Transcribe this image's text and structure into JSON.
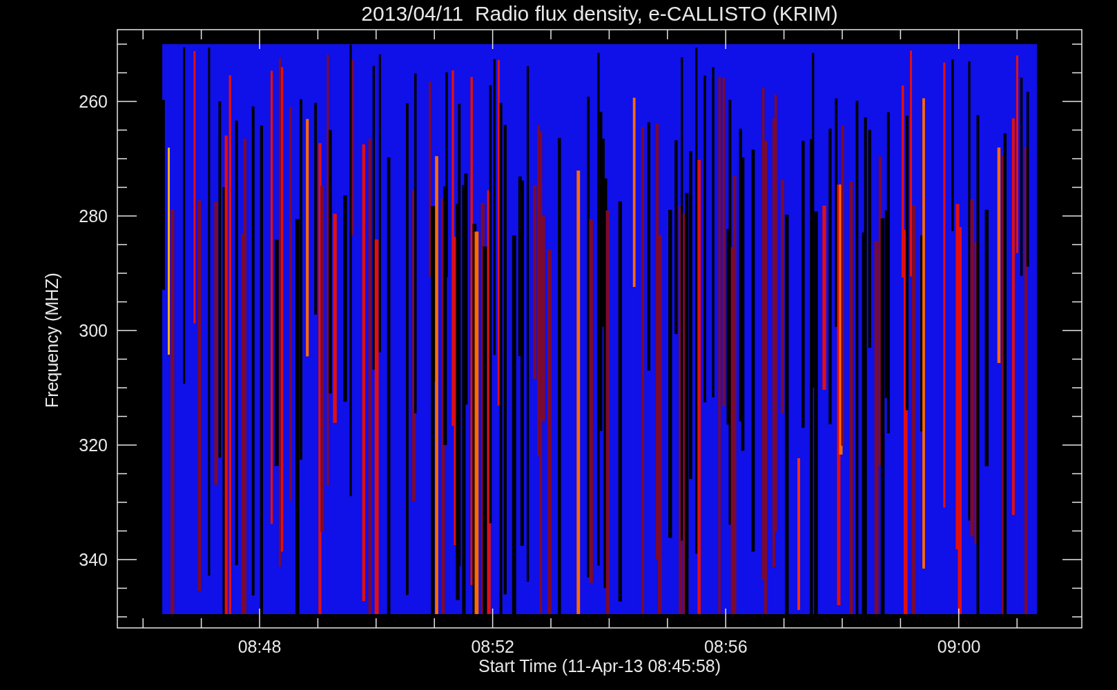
{
  "title": "2013/04/11  Radio flux density, e-CALLISTO (KRIM)",
  "y_axis": {
    "label": "Frequency (MHZ)",
    "ticks": [
      "260",
      "280",
      "300",
      "320",
      "340"
    ]
  },
  "x_axis": {
    "label": "Start Time (11-Apr-13 08:45:58)",
    "ticks": [
      "08:48",
      "08:52",
      "08:56",
      "09:00"
    ]
  }
}
